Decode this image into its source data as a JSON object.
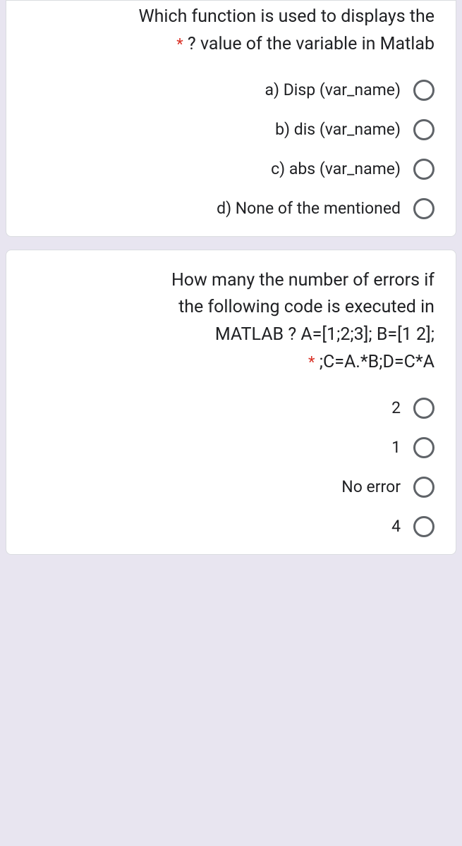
{
  "question1": {
    "text_line1": "Which function is used to displays the",
    "text_line2": "? value of the variable in Matlab",
    "required": "*",
    "options": [
      "a) Disp (var_name)",
      "b) dis (var_name)",
      "c) abs (var_name)",
      "d) None of the mentioned"
    ]
  },
  "question2": {
    "text_line1": "How many the number of errors if",
    "text_line2": "the following code is executed in",
    "text_line3": "MATLAB ?   A=[1;2;3]; B=[1 2];",
    "text_line4": ";C=A.*B;D=C*A",
    "required": "*",
    "options": [
      "2",
      "1",
      "No error",
      "4"
    ]
  }
}
